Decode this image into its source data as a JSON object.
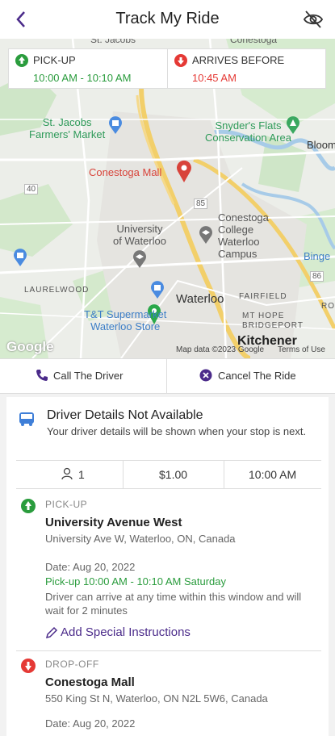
{
  "header": {
    "title": "Track My Ride",
    "back_icon": "back-chevron-icon",
    "toggle_icon": "eye-off-icon"
  },
  "times": {
    "pickup_label": "PICK-UP",
    "pickup_value": "10:00 AM - 10:10 AM",
    "arrives_label": "ARRIVES BEFORE",
    "arrives_value": "10:45 AM"
  },
  "map": {
    "labels": {
      "st_jacobs": "St. Jacobs",
      "conestoga_top": "Conestoga",
      "market": "St. Jacobs\nFarmers' Market",
      "snyders": "Snyder's Flats\nConservation Area",
      "bloom": "Bloom",
      "conestoga_mall": "Conestoga Mall",
      "road_85": "85",
      "road_40": "40",
      "road_86": "86",
      "university": "University\nof Waterloo",
      "college": "Conestoga\nCollege\nWaterloo\nCampus",
      "bingemans": "Binge",
      "laurelwood": "LAURELWOOD",
      "waterloo": "Waterloo",
      "fairfield": "FAIRFIELD",
      "mt_hope": "MT HOPE\nBRIDGEPORT",
      "tt": "T&T Supermarket\nWaterloo Store",
      "kitchener": "Kitchener",
      "ros": "ROS",
      "google": "Google",
      "mapdata": "Map data ©2023 Google",
      "terms": "Terms of Use"
    }
  },
  "actions": {
    "call": "Call The Driver",
    "cancel": "Cancel The Ride"
  },
  "driver": {
    "title": "Driver Details Not Available",
    "subtitle": "Your driver details will be shown when your stop is next."
  },
  "stats": {
    "passengers": "1",
    "fare": "$1.00",
    "time": "10:00 AM"
  },
  "pickup": {
    "kind": "PICK-UP",
    "name": "University Avenue West",
    "address": "University Ave W, Waterloo, ON, Canada",
    "date": "Date: Aug 20, 2022",
    "window": "Pick-up 10:00 AM - 10:10 AM Saturday",
    "note": "Driver can arrive at any time within this window and will wait for 2 minutes",
    "instructions": "Add Special Instructions"
  },
  "dropoff": {
    "kind": "DROP-OFF",
    "name": "Conestoga Mall",
    "address": "550 King St N, Waterloo, ON N2L 5W6, Canada",
    "date": "Date: Aug 20, 2022"
  },
  "colors": {
    "accent": "#4b2b8a",
    "green": "#2a9c3d",
    "red": "#e53935"
  }
}
